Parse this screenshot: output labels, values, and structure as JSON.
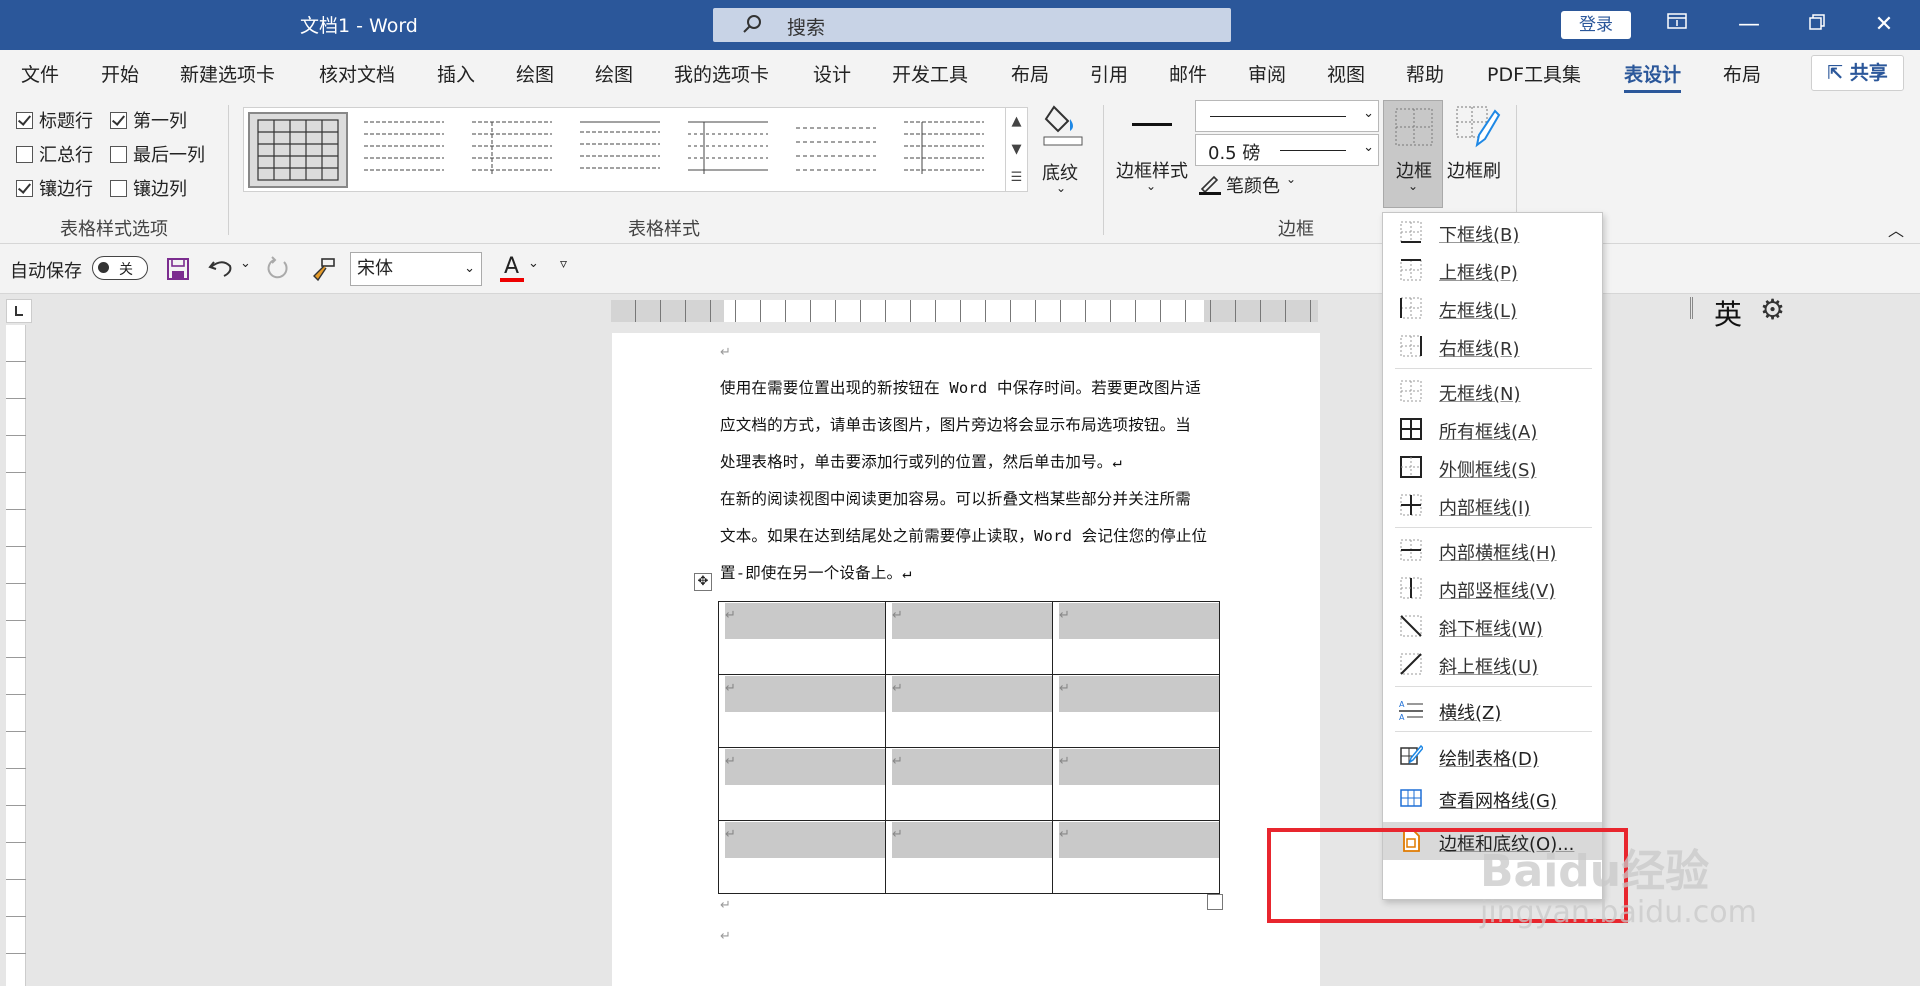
{
  "title_bar": {
    "doc_title": "文档1  -  Word",
    "search_placeholder": "搜索",
    "login": "登录"
  },
  "menu_tabs": [
    "文件",
    "开始",
    "新建选项卡",
    "核对文档",
    "插入",
    "绘图",
    "绘图",
    "我的选项卡",
    "设计",
    "开发工具",
    "布局",
    "引用",
    "邮件",
    "审阅",
    "视图",
    "帮助",
    "PDF工具集",
    "表设计",
    "布局"
  ],
  "active_tab": "表设计",
  "share": "共享",
  "ribbon": {
    "options_group": {
      "label": "表格样式选项",
      "items": [
        {
          "label": "标题行",
          "checked": true
        },
        {
          "label": "第一列",
          "checked": true
        },
        {
          "label": "汇总行",
          "checked": false
        },
        {
          "label": "最后一列",
          "checked": false
        },
        {
          "label": "镶边行",
          "checked": true
        },
        {
          "label": "镶边列",
          "checked": false
        }
      ]
    },
    "styles_group": {
      "label": "表格样式"
    },
    "shading": "底纹",
    "border_style": "边框样式",
    "pen_weight": "0.5 磅",
    "pen_color": "笔颜色",
    "borders_group_label": "边框",
    "borders_btn": "边框",
    "border_painter": "边框刷"
  },
  "qat": {
    "autosave": "自动保存",
    "autosave_state": "关",
    "font": "宋体"
  },
  "document": {
    "paragraphs": [
      "使用在需要位置出现的新按钮在 Word 中保存时间。若要更改图片适",
      "应文档的方式，请单击该图片，图片旁边将会显示布局选项按钮。当",
      "处理表格时，单击要添加行或列的位置，然后单击加号。↵",
      "在新的阅读视图中阅读更加容易。可以折叠文档某些部分并关注所需",
      "文本。如果在达到结尾处之前需要停止读取，Word 会记住您的停止位",
      "置-即使在另一个设备上。↵"
    ],
    "para_mark": "↵"
  },
  "ime": "英",
  "border_menu": [
    {
      "label": "下框线(B)",
      "icon": "bottom-border-icon"
    },
    {
      "label": "上框线(P)",
      "icon": "top-border-icon"
    },
    {
      "label": "左框线(L)",
      "icon": "left-border-icon"
    },
    {
      "label": "右框线(R)",
      "icon": "right-border-icon"
    },
    {
      "label": "无框线(N)",
      "icon": "no-border-icon"
    },
    {
      "label": "所有框线(A)",
      "icon": "all-borders-icon"
    },
    {
      "label": "外侧框线(S)",
      "icon": "outside-borders-icon"
    },
    {
      "label": "内部框线(I)",
      "icon": "inside-borders-icon"
    },
    {
      "label": "内部横框线(H)",
      "icon": "inside-horizontal-border-icon"
    },
    {
      "label": "内部竖框线(V)",
      "icon": "inside-vertical-border-icon"
    },
    {
      "label": "斜下框线(W)",
      "icon": "diagonal-down-border-icon"
    },
    {
      "label": "斜上框线(U)",
      "icon": "diagonal-up-border-icon"
    },
    {
      "label": "横线(Z)",
      "icon": "horizontal-line-icon"
    },
    {
      "label": "绘制表格(D)",
      "icon": "draw-table-icon"
    },
    {
      "label": "查看网格线(G)",
      "icon": "view-gridlines-icon"
    },
    {
      "label": "边框和底纹(O)...",
      "icon": "borders-shading-icon"
    }
  ],
  "watermark": {
    "text": "Baidu经验",
    "url": "jingyan.baidu.com"
  }
}
